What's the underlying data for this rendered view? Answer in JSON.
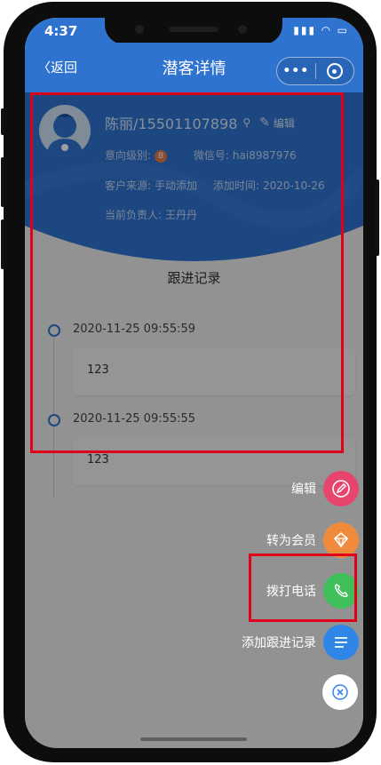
{
  "status_bar": {
    "time": "4:37"
  },
  "nav": {
    "back_label": "返回",
    "title": "潜客详情",
    "more_label": "•••"
  },
  "customer": {
    "name_phone": "陈丽/15501107898",
    "edit_label": "编辑",
    "intent_label": "意向级别:",
    "intent_value": "B",
    "wechat_label": "微信号:",
    "wechat_value": "hai8987976",
    "source_label": "客户来源:",
    "source_value": "手动添加",
    "added_label": "添加时间:",
    "added_value": "2020-10-26",
    "owner_label": "当前负责人:",
    "owner_value": "王丹丹"
  },
  "followups": {
    "title": "跟进记录",
    "items": [
      {
        "time": "2020-11-25 09:55:59",
        "content": "123"
      },
      {
        "time": "2020-11-25 09:55:55",
        "content": "123"
      }
    ]
  },
  "fab_menu": {
    "items": [
      {
        "label": "编辑",
        "icon": "pencil-icon",
        "color": "#e8456e"
      },
      {
        "label": "转为会员",
        "icon": "diamond-icon",
        "color": "#f08a3c"
      },
      {
        "label": "拨打电话",
        "icon": "phone-icon",
        "color": "#3fbf5a"
      },
      {
        "label": "添加跟进记录",
        "icon": "list-icon",
        "color": "#2f86e6"
      }
    ],
    "close_icon": "close-icon"
  },
  "colors": {
    "primary": "#2f73d0",
    "highlight": "#e0001a"
  }
}
